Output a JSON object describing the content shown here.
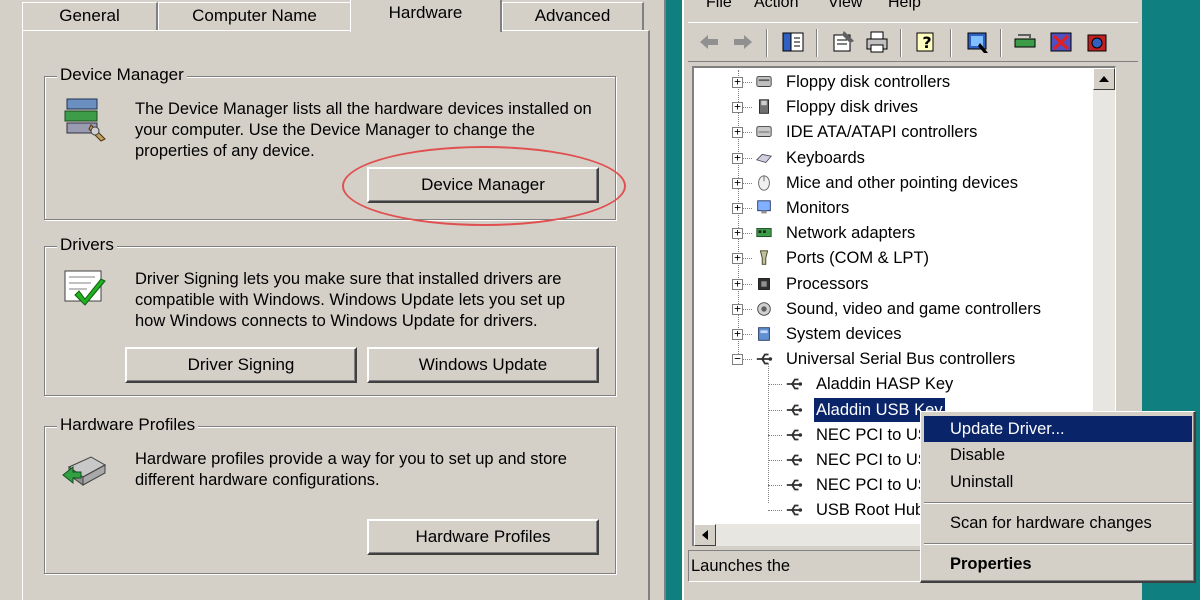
{
  "dialog": {
    "tabs": [
      "General",
      "Computer Name",
      "Hardware",
      "Advanced"
    ],
    "active_tab": "Hardware",
    "device_manager": {
      "title": "Device Manager",
      "text": "The Device Manager lists all the hardware devices installed on your computer. Use the Device Manager to change the properties of any device.",
      "button": "Device Manager"
    },
    "drivers": {
      "title": "Drivers",
      "text": "Driver Signing lets you make sure that installed drivers are compatible with Windows. Windows Update lets you set up how Windows connects to Windows Update for drivers.",
      "button_signing": "Driver Signing",
      "button_update": "Windows Update"
    },
    "hardware_profiles": {
      "title": "Hardware Profiles",
      "text": "Hardware profiles provide a way for you to set up and store different hardware configurations.",
      "button": "Hardware Profiles"
    }
  },
  "device_manager_window": {
    "menu": [
      "File",
      "Action",
      "View",
      "Help"
    ],
    "tree": [
      {
        "label": "Floppy disk controllers",
        "icon": "floppy-controller-icon",
        "expander": "+"
      },
      {
        "label": "Floppy disk drives",
        "icon": "floppy-drive-icon",
        "expander": "+"
      },
      {
        "label": "IDE ATA/ATAPI controllers",
        "icon": "ide-controller-icon",
        "expander": "+"
      },
      {
        "label": "Keyboards",
        "icon": "keyboard-icon",
        "expander": "+"
      },
      {
        "label": "Mice and other pointing devices",
        "icon": "mouse-icon",
        "expander": "+"
      },
      {
        "label": "Monitors",
        "icon": "monitor-icon",
        "expander": "+"
      },
      {
        "label": "Network adapters",
        "icon": "network-adapter-icon",
        "expander": "+"
      },
      {
        "label": "Ports (COM & LPT)",
        "icon": "port-icon",
        "expander": "+"
      },
      {
        "label": "Processors",
        "icon": "processor-icon",
        "expander": "+"
      },
      {
        "label": "Sound, video and game controllers",
        "icon": "sound-icon",
        "expander": "+"
      },
      {
        "label": "System devices",
        "icon": "system-devices-icon",
        "expander": "+"
      },
      {
        "label": "Universal Serial Bus controllers",
        "icon": "usb-icon",
        "expander": "−"
      }
    ],
    "usb_children": [
      "Aladdin HASP Key",
      "Aladdin USB Key",
      "NEC PCI to US",
      "NEC PCI to US",
      "NEC PCI to US",
      "USB Root Hub"
    ],
    "selected_child": "Aladdin USB Key",
    "status_text": "Launches the"
  },
  "context_menu": {
    "items": [
      "Update Driver...",
      "Disable",
      "Uninstall",
      "Scan for hardware changes",
      "Properties"
    ],
    "highlighted": "Update Driver...",
    "default": "Properties"
  },
  "colors": {
    "desktop": "#0f7f80",
    "window_face": "#d4d0c8",
    "selection": "#0a246a",
    "annotation_ellipse": "#e05050"
  }
}
